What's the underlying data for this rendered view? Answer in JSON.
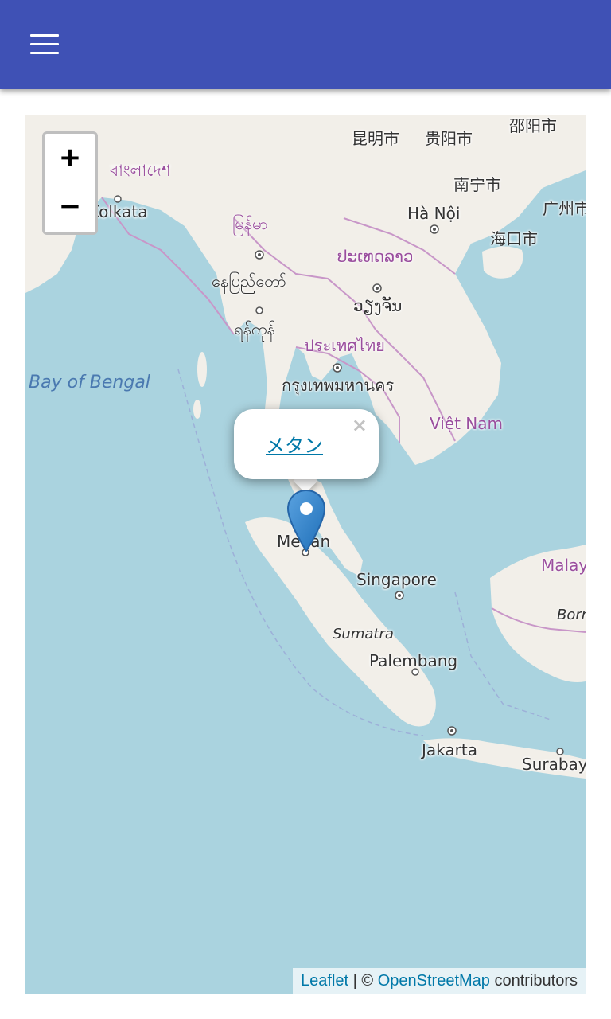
{
  "appbar": {
    "background": "#3f51b5",
    "menu_icon": "hamburger-menu-icon"
  },
  "map": {
    "zoom_in_label": "+",
    "zoom_out_label": "−",
    "labels": {
      "kunming": "昆明市",
      "guiyang": "贵阳市",
      "shaoyang": "邵阳市",
      "bangladesh": "বাংলাদেশ",
      "nanning": "南宁市",
      "kolkata": "Kolkata",
      "hanoi": "Hà Nội",
      "guangzhou": "广州市",
      "myanmar": "မြန်မာ",
      "haikou": "海口市",
      "laos": "ປະເທດລາວ",
      "naypyidaw": "နေပြည်တော်",
      "vientiane": "ວຽງຈັນ",
      "yangon": "ရန်ကုန်",
      "thailand": "ประเทศไทย",
      "bay_of_bengal": "Bay of Bengal",
      "bangkok": "กรุงเทพมหานคร",
      "vietnam": "Việt Nam",
      "medan": "Medan",
      "malaysia": "Malay",
      "singapore": "Singapore",
      "borneo": "Borr",
      "sumatra": "Sumatra",
      "palembang": "Palembang",
      "jakarta": "Jakarta",
      "surabaya": "Surabay"
    },
    "popup": {
      "link_text": "メタン",
      "close_label": "×"
    },
    "attribution": {
      "leaflet": "Leaflet",
      "separator": " | © ",
      "osm": "OpenStreetMap",
      "suffix": " contributors"
    }
  }
}
